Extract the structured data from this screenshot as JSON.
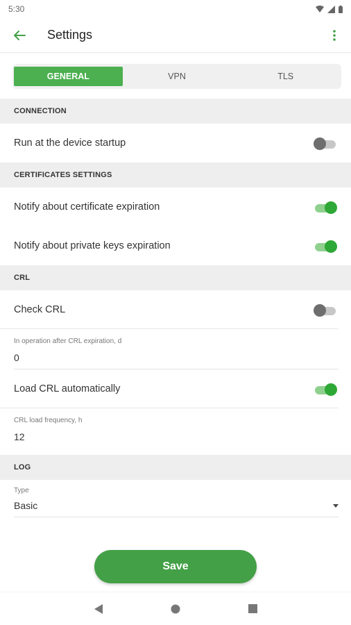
{
  "status_bar": {
    "time": "5:30"
  },
  "app_bar": {
    "title": "Settings"
  },
  "tabs": [
    {
      "label": "GENERAL",
      "active": true
    },
    {
      "label": "VPN",
      "active": false
    },
    {
      "label": "TLS",
      "active": false
    }
  ],
  "sections": {
    "connection": {
      "title": "CONNECTION",
      "run_at_startup": {
        "label": "Run at the device startup",
        "enabled": false
      }
    },
    "certificates": {
      "title": "CERTIFICATES SETTINGS",
      "notify_cert_expiration": {
        "label": "Notify about certificate expiration",
        "enabled": true
      },
      "notify_keys_expiration": {
        "label": "Notify about private keys expiration",
        "enabled": true
      }
    },
    "crl": {
      "title": "CRL",
      "check_crl": {
        "label": "Check CRL",
        "enabled": false
      },
      "operation_after_expiration": {
        "label": "In operation after CRL expiration, d",
        "value": "0"
      },
      "load_automatically": {
        "label": "Load CRL automatically",
        "enabled": true
      },
      "load_frequency": {
        "label": "CRL load frequency, h",
        "value": "12"
      }
    },
    "log": {
      "title": "LOG",
      "type": {
        "label": "Type",
        "value": "Basic"
      }
    }
  },
  "save_button": {
    "label": "Save"
  },
  "colors": {
    "accent": "#4caf50",
    "switch_on": "#2ea836",
    "section_bg": "#eeeeee"
  }
}
